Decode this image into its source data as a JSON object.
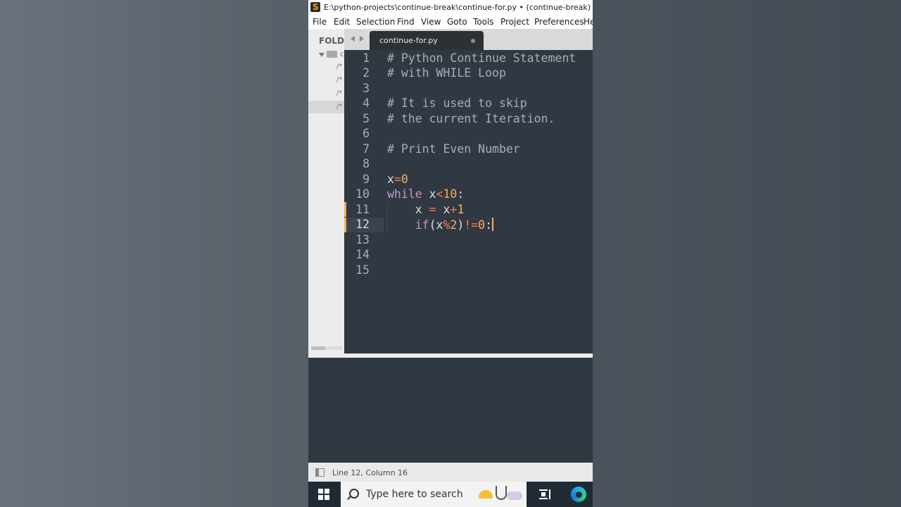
{
  "window": {
    "title": "E:\\python-projects\\continue-break\\continue-for.py • (continue-break) - Subli"
  },
  "menu": [
    "File",
    "Edit",
    "Selection",
    "Find",
    "View",
    "Goto",
    "Tools",
    "Project",
    "Preferences",
    "He"
  ],
  "sidebar": {
    "header": "FOLDE",
    "folder": "c",
    "files": [
      "/*",
      "/*",
      "/*",
      "/*"
    ]
  },
  "tab": {
    "label": "continue-for.py"
  },
  "editor": {
    "line_numbers": [
      "1",
      "2",
      "3",
      "4",
      "5",
      "6",
      "7",
      "8",
      "9",
      "10",
      "11",
      "12",
      "13",
      "14",
      "15"
    ],
    "current_line": "12",
    "lines": {
      "l1": "# Python Continue Statement",
      "l2": "# with WHILE Loop",
      "l4": "# It is used to skip",
      "l5": "# the current Iteration.",
      "l7": "# Print Even Number",
      "l9": {
        "a": "x",
        "b": "=",
        "c": "0"
      },
      "l10": {
        "a": "while",
        "b": " x",
        "c": "<",
        "d": "10",
        "e": ":"
      },
      "l11": {
        "a": "    x ",
        "b": "=",
        "c": " x",
        "d": "+",
        "e": "1"
      },
      "l12": {
        "a": "    if",
        "b": "(x",
        "c": "%",
        "d": "2",
        "e": ")",
        "f": "!=",
        "g": "0",
        "h": ":"
      }
    }
  },
  "status": {
    "text": "Line 12, Column 16"
  },
  "taskbar": {
    "search_placeholder": "Type here to search"
  },
  "colors": {
    "editor_bg": "#303841",
    "comment": "#a7adba",
    "keyword": "#c695c6",
    "number": "#f9ae58",
    "operator": "#f97b58"
  }
}
